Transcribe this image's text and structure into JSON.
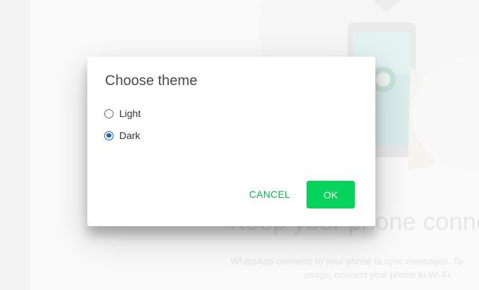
{
  "background": {
    "title": "Keep your phone conne",
    "subtitle_line1": "WhatsApp connects to your phone to sync messages. To",
    "subtitle_line2": "usage, connect your phone to Wi-Fi."
  },
  "dialog": {
    "title": "Choose theme",
    "options": [
      {
        "label": "Light",
        "checked": false
      },
      {
        "label": "Dark",
        "checked": true
      }
    ],
    "cancel_label": "CANCEL",
    "ok_label": "OK"
  },
  "colors": {
    "accent_green": "#06d35a",
    "cancel_text": "#07bc4c",
    "radio_selected": "#1e63c3"
  }
}
